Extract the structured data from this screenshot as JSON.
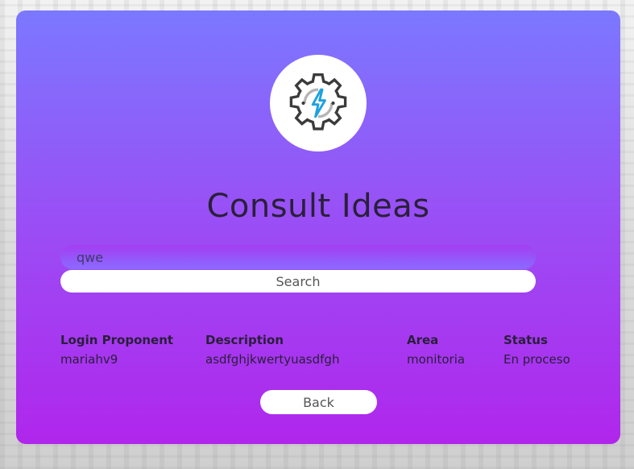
{
  "page": {
    "title": "Consult Ideas",
    "logo_icon": "gear-lightning-icon"
  },
  "search": {
    "value": "qwe",
    "button_label": "Search"
  },
  "results": {
    "columns": {
      "login": "Login Proponent",
      "description": "Description",
      "area": "Area",
      "status": "Status"
    },
    "row": {
      "login": "mariahv9",
      "description": "asdfghjkwertyuasdfgh",
      "area": "monitoria",
      "status": "En proceso"
    }
  },
  "actions": {
    "back_label": "Back"
  },
  "colors": {
    "card_top": "#7b78ff",
    "card_bottom": "#b026ec",
    "title_text": "#2a1f3a",
    "icon_accent": "#1fa2df"
  }
}
